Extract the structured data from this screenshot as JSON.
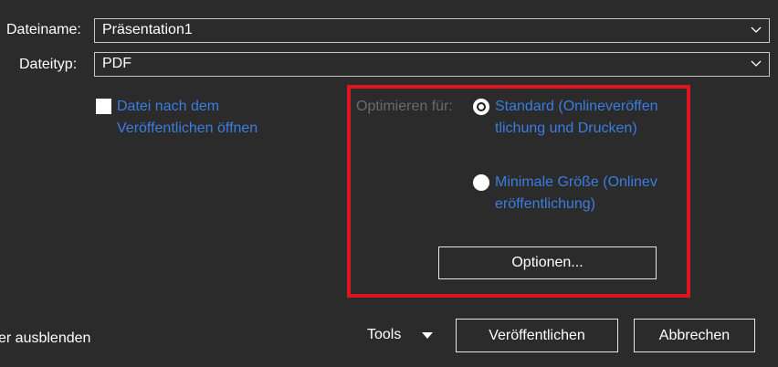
{
  "filename": {
    "label": "Dateiname:",
    "value": "Präsentation1"
  },
  "filetype": {
    "label": "Dateityp:",
    "value": "PDF"
  },
  "open_after_publish": {
    "label": "Datei nach dem Veröffentlichen öffnen",
    "checked": false
  },
  "optimize": {
    "label": "Optimieren für:",
    "options": [
      {
        "label": "Standard (Onlineveröffentlichung und Drucken)",
        "selected": true
      },
      {
        "label": "Minimale Größe (Onlineveröffentlichung)",
        "selected": false
      }
    ],
    "options_button": "Optionen..."
  },
  "footer": {
    "hide_folders_label": "er ausblenden",
    "tools_label": "Tools",
    "publish_button": "Veröffentlichen",
    "cancel_button": "Abbrechen"
  },
  "colors": {
    "background": "#2b2b2b",
    "link_blue": "#3b7de0",
    "highlight_red": "#e0141e",
    "disabled_gray": "#6b6b6b"
  }
}
